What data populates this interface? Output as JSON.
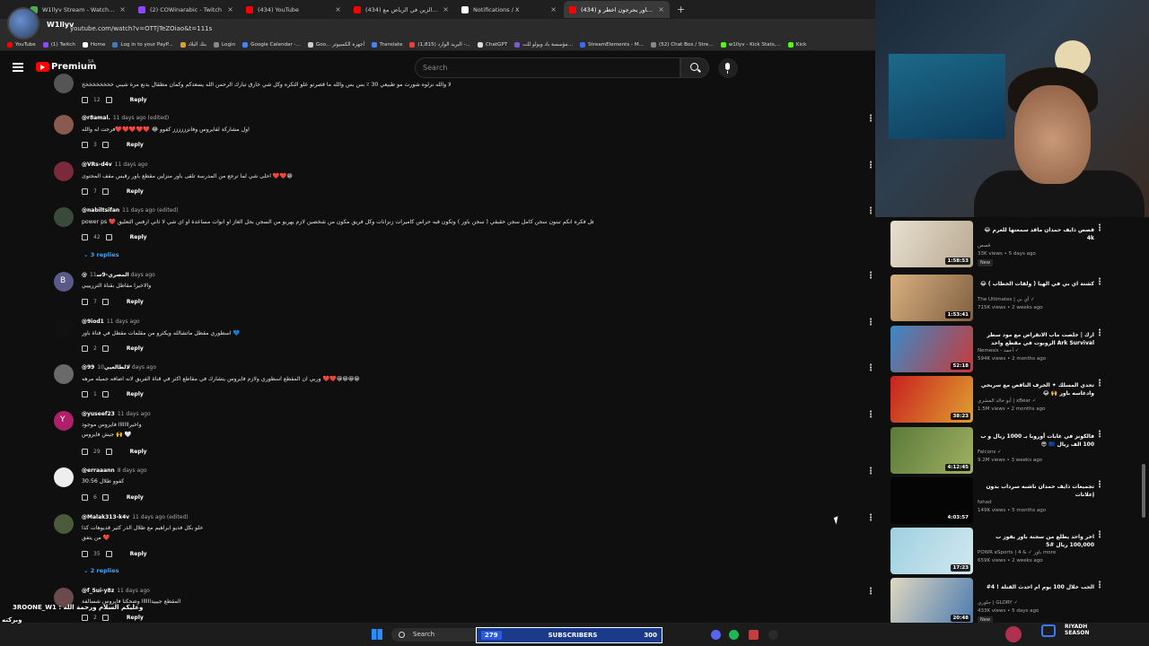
{
  "browser": {
    "tabs": [
      {
        "title": "W1llyv Stream - Watch Live on",
        "color": "#4caf50",
        "active": false
      },
      {
        "title": "(2) COWinarabic - Twitch",
        "color": "#9146ff",
        "active": false
      },
      {
        "title": "(434) YouTube",
        "color": "#ff0000",
        "active": false
      },
      {
        "title": "(434) تحدي الزين في الرياض مع",
        "color": "#ff0000",
        "active": false
      },
      {
        "title": "Notifications / X",
        "color": "#ffffff",
        "active": false
      },
      {
        "title": "(434) اعضاء باور يحرجون اخطر و",
        "color": "#ff0000",
        "active": true
      }
    ],
    "new_tab": "+",
    "url": "youtube.com/watch?v=OTTjTeZOiao&t=111s",
    "profile_name": "W1llyv",
    "bookmarks": [
      "YouTube",
      "(1) Twitch",
      "Home",
      "Log in to your PayP...",
      "بنك البلاد",
      "Login",
      "Google Calendar -...",
      "Goo... أجهزة الكمبيوتر",
      "Translate",
      "البريد الوارد (1,815) -...",
      "ChatGPT",
      "مؤسسة باد ويولو للت...",
      "StreamElements - M...",
      "(52) Chat Box / Stre...",
      "w1llyv - Kick Stats,...",
      "Kick"
    ]
  },
  "youtube": {
    "brand": "Premium",
    "country": "SA",
    "search_placeholder": "Search"
  },
  "comments": [
    {
      "user": "",
      "time": "",
      "text": "لا والله نزلوه شورت مو طبيعي 30 ٪ بس بس والله ما قصرتو علو التكره وكل شي خارق تبارك الرحمن الله يسعدكم وكمان مطقال بدنع مرة شيبي خخخخخخخخخ",
      "text2": "",
      "likes": "12",
      "avatar": "#555555",
      "replies": ""
    },
    {
      "user": "@r8amal.",
      "time": "11 days ago (edited)",
      "text": "اول مشاركة لفايروس وفانزززززز كفوو 😂 ❤️❤️❤️❤️❤️فرحت له والله",
      "text2": "",
      "likes": "3",
      "avatar": "#8a5a50",
      "replies": ""
    },
    {
      "user": "@VRs-d4v",
      "time": "11 days ago",
      "text": "احلى شي لما ترجع من المدرسة تلقى باور منزلين مقطع باور رقبس مقف المحتوى ❤️❤️😁",
      "text2": "",
      "likes": "7",
      "avatar": "#7a2a3a",
      "replies": ""
    },
    {
      "user": "@nabiltsifan",
      "time": "11 days ago (edited)",
      "text": "power ps ❤️ المقص صور هل فكره انكم تبنون سجن كامل سجن حقيقي ( سجن باور ) وتكون فيه حراس كاميرات زنزانات وكل فريق مكون من شخصين لازم يهربو من السجن بحل الغاز او انوات مساعدة او اي شي لا ثاني ارفس التعليق",
      "text2": "",
      "likes": "42",
      "avatar": "#3a4a3a",
      "replies": "3 replies"
    },
    {
      "user": "@ﺍﻟﻤﺼﺮﻱ-9ﺳ",
      "time": "11 days ago",
      "text": "والاخيرا مقاطل بقناة الترريييي",
      "text2": "",
      "likes": "7",
      "avatar": "#5a5a8a",
      "replies": ""
    },
    {
      "user": "@9iod1",
      "time": "11 days ago",
      "text": "اسطوري مقطل ماتشالله ويكثرو من مقلمات مقطل في قناة باور 💙",
      "text2": "",
      "likes": "2",
      "avatar": "#111111",
      "replies": ""
    },
    {
      "user": "@99لالطالعيي",
      "time": "10 days ago",
      "text": "وربي ان المقطع اسطوري ولازم فايروس يتشارك في مقاطع اكثر في قناة الفريق لانه اضافه جميله مرهه ❤️❤️😀😀😀😀",
      "text2": "",
      "likes": "1",
      "avatar": "#6a6a6a",
      "replies": ""
    },
    {
      "user": "@yuseef23",
      "time": "11 days ago",
      "text": "واخيرااااااا فايروس موجود",
      "text2": "جيش فايروس 🙌 🤍",
      "likes": "29",
      "avatar": "#b0206a",
      "replies": ""
    },
    {
      "user": "@erraaann",
      "time": "8 days ago",
      "text": "كفوو طلال 30:56",
      "text2": "",
      "likes": "6",
      "avatar": "#eeeeee",
      "replies": ""
    },
    {
      "user": "@Malak313-k4v",
      "time": "11 days ago (edited)",
      "text": "خلو بكل فديو ابراهيم مع طلال الذر كثير قديوهات كذا",
      "text2": "من يتفق ❤️",
      "likes": "35",
      "avatar": "#4a5a3a",
      "replies": "2 replies"
    },
    {
      "user": "@f_5ui-y8z",
      "time": "11 days ago",
      "text": "المقطع جيييداااااا وضحكنا فايروس شسالفة",
      "text2": "",
      "likes": "2",
      "avatar": "#6a4a4a",
      "replies": ""
    }
  ],
  "reply_label": "Reply",
  "recommendations": [
    {
      "title": "قصص ذايف حمدان ماقد سمعتها للعرم 😂 4k",
      "channel": "قصص",
      "meta": "33K views • 5 days ago",
      "badge": "New",
      "duration": "1:58:53",
      "color": "#d8d0c0"
    },
    {
      "title": "كشتة اي بي في الهيا ( ولقات الخطاب ) 😂",
      "channel": "The Ultimates | آي بي ✓",
      "meta": "715K views • 2 weeks ago",
      "badge": "",
      "duration": "1:53:41",
      "color": "#c8a070"
    },
    {
      "title": "ارك | خلصت ماب الانقراض مع مود سطر Ark Survival الروبوت في مقطع واحد",
      "channel": "Nemesis - أحمد ✓",
      "meta": "594K views • 2 months ago",
      "badge": "",
      "duration": "52:18",
      "color": "#3a8ac8"
    },
    {
      "title": "تحدي المسلك ✦ الحرف الناقص مع سربحي وادغاسه باور 🙌 😂",
      "channel": "أبو خالد المشري | xBear ✓",
      "meta": "1.5M views • 2 months ago",
      "badge": "",
      "duration": "38:23",
      "color": "#b02020"
    },
    {
      "title": "فالكونز في غابات أوروبا بـ 1000 ريال و ب 100 الف ريال 🇪🇺 😎",
      "channel": "Falcons ✓",
      "meta": "9.2M views • 3 weeks ago",
      "badge": "",
      "duration": "4:12:45",
      "color": "#6a8a3a"
    },
    {
      "title": "تجميعات ذايف حمدان ناشبه سرداب بدون إعلانات",
      "channel": "fahad",
      "meta": "149K views • 5 months ago",
      "badge": "",
      "duration": "4:03:57",
      "color": "#050505"
    },
    {
      "title": "اخر واحد يطلع من سجنة باور يفوز ب 100,000 ريال #5",
      "channel": "POWR eSports | باور ✓ & 4 more",
      "meta": "659K views • 2 weeks ago",
      "badge": "",
      "duration": "17:23",
      "color": "#8ac0d8"
    },
    {
      "title": "الحب خلال 100 يوم ام احدث القتلة ! 4#",
      "channel": "جلوري | GLORY ✓",
      "meta": "433K views • 5 days ago",
      "badge": "New",
      "duration": "20:48",
      "color": "#d0c8b0"
    }
  ],
  "chat_overlay": {
    "line1": "3ROONE_W1 : وعليكم السلام ورحمة الله",
    "line2": "وبركته"
  },
  "taskbar": {
    "search_label": "Search",
    "subscribers_label": "SUBSCRIBERS",
    "subscribers_current": "279",
    "subscribers_goal": "300",
    "sponsor": "RIYADH SEASON"
  }
}
